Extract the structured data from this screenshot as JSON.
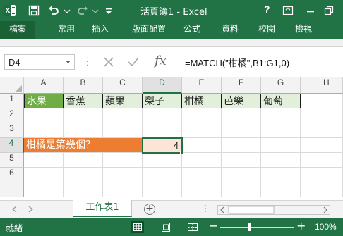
{
  "window": {
    "title": "活頁簿1 - Excel",
    "help": "?"
  },
  "ribbon": {
    "tabs": [
      {
        "label": "檔案"
      },
      {
        "label": "常用"
      },
      {
        "label": "插入"
      },
      {
        "label": "版面配置"
      },
      {
        "label": "公式"
      },
      {
        "label": "資料"
      },
      {
        "label": "校閱"
      },
      {
        "label": "檢視"
      }
    ]
  },
  "formula_bar": {
    "name_box": "D4",
    "fx": "fx",
    "formula": "=MATCH(\"柑橘\",B1:G1,0)"
  },
  "grid": {
    "columns": [
      "A",
      "B",
      "C",
      "D",
      "E",
      "F",
      "G",
      "H"
    ],
    "rows": [
      "1",
      "2",
      "3",
      "4",
      "5",
      "6"
    ],
    "selected_cell": "D4",
    "cells": {
      "A1": "水果",
      "B1": "香蕉",
      "C1": "蘋果",
      "D1": "梨子",
      "E1": "柑橘",
      "F1": "芭樂",
      "G1": "葡萄",
      "A4": "柑橘是第幾個？",
      "D4": "4"
    }
  },
  "sheets": {
    "active": "工作表1",
    "add": "+"
  },
  "status": {
    "text": "就緒",
    "zoom": "100%",
    "zoom_minus": "−",
    "zoom_plus": "+"
  },
  "colors": {
    "excel_green": "#217346",
    "header_fill": "#e2efda",
    "first_header_fill": "#70ad47",
    "question_fill": "#ed7d31",
    "answer_fill": "#fce4d6"
  },
  "icons": [
    "excel-logo-icon",
    "save-icon",
    "undo-icon",
    "redo-icon",
    "customize-qat-icon",
    "help-icon",
    "ribbon-display-icon",
    "minimize-icon",
    "restore-icon",
    "name-box-dropdown-icon",
    "cancel-icon",
    "enter-icon",
    "insert-function-icon",
    "add-sheet-icon",
    "normal-view-icon",
    "page-layout-view-icon",
    "page-break-view-icon"
  ]
}
